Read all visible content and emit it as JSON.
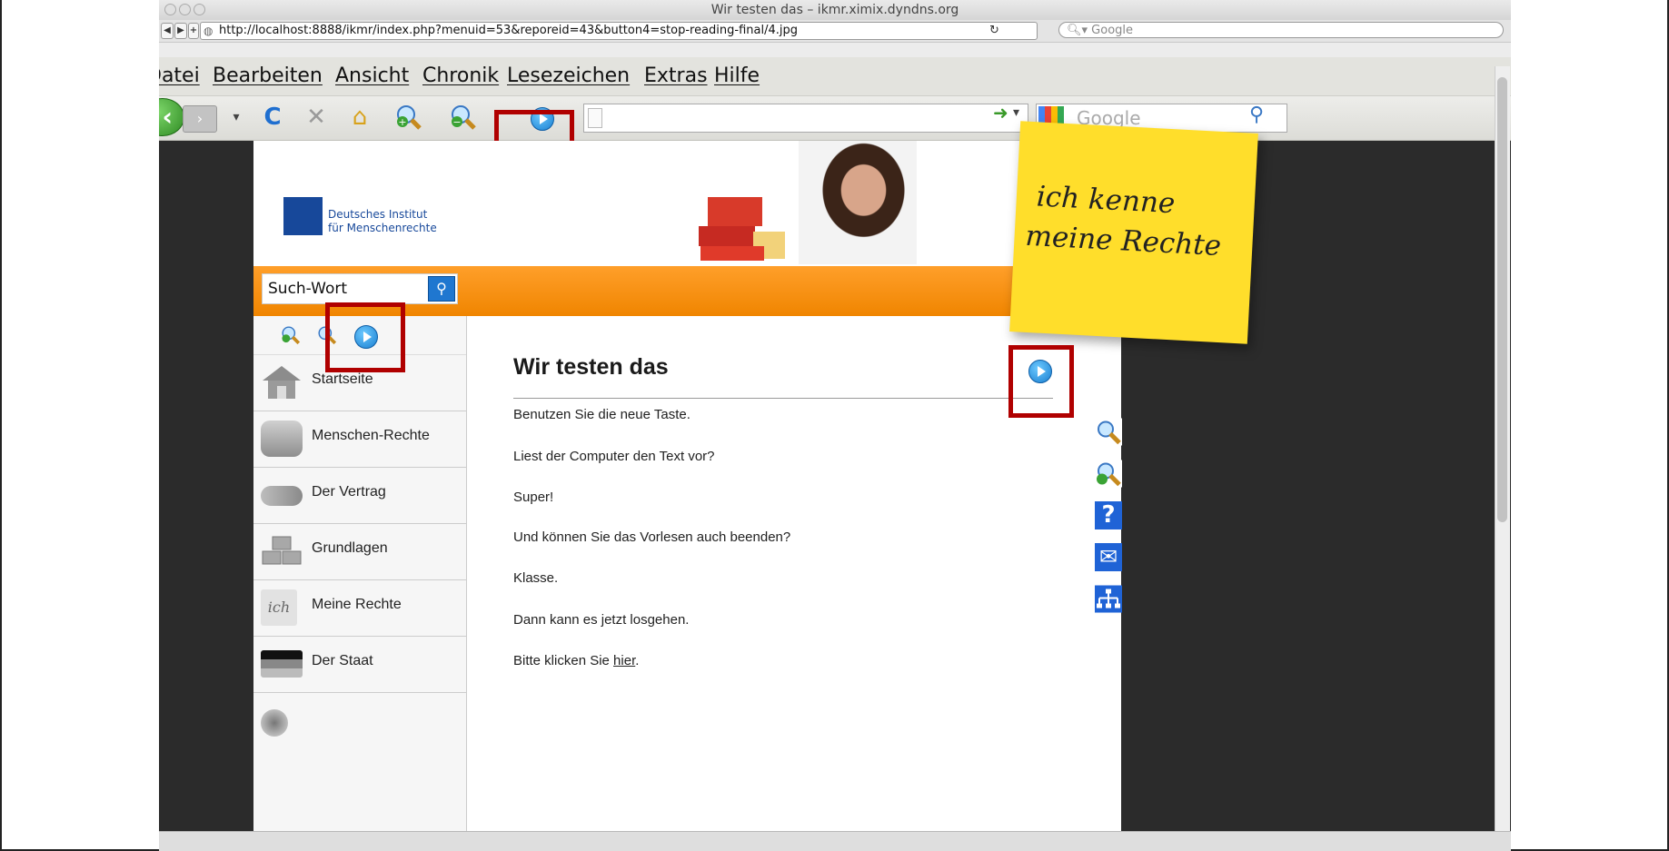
{
  "window": {
    "title": "Wir testen das – ikmr.ximix.dyndns.org"
  },
  "url_bar": {
    "url": "http://localhost:8888/ikmr/index.php?menuid=53&reporeid=43&button4=stop-reading-final/4.jpg",
    "search_placeholder": "Google"
  },
  "menu": [
    "Datei",
    "Bearbeiten",
    "Ansicht",
    "Chronik",
    "Lesezeichen",
    "Extras",
    "Hilfe"
  ],
  "toolbar": {
    "search_placeholder": "Google"
  },
  "site": {
    "logo_line1": "Deutsches Institut",
    "logo_line2": "für Menschenrechte",
    "search_label": "Such-Wort",
    "sticky_line1": "ich kenne",
    "sticky_line2": "meine Rechte",
    "nav": [
      {
        "label": "Startseite",
        "icon": "house-icon"
      },
      {
        "label": "Menschen-Rechte",
        "icon": "people-icon"
      },
      {
        "label": "Der Vertrag",
        "icon": "handshake-icon"
      },
      {
        "label": "Grundlagen",
        "icon": "blocks-icon"
      },
      {
        "label": "Meine Rechte",
        "icon": "ich-icon",
        "icon_text": "ich"
      },
      {
        "label": "Der Staat",
        "icon": "flag-icon"
      }
    ],
    "content": {
      "title": "Wir testen das",
      "paragraphs": [
        "Benutzen Sie die neue Taste.",
        "Liest der Computer den Text vor?",
        "Super!",
        "Und können Sie das Vorlesen auch beenden?",
        "Klasse.",
        "Dann kann es jetzt losgehen."
      ],
      "last_prefix": "Bitte klicken Sie ",
      "last_link": "hier",
      "last_suffix": "."
    }
  },
  "colors": {
    "accent_orange": "#f08500",
    "highlight_red": "#b00000",
    "sticky_yellow": "#ffde2b",
    "brand_blue": "#17489a"
  }
}
